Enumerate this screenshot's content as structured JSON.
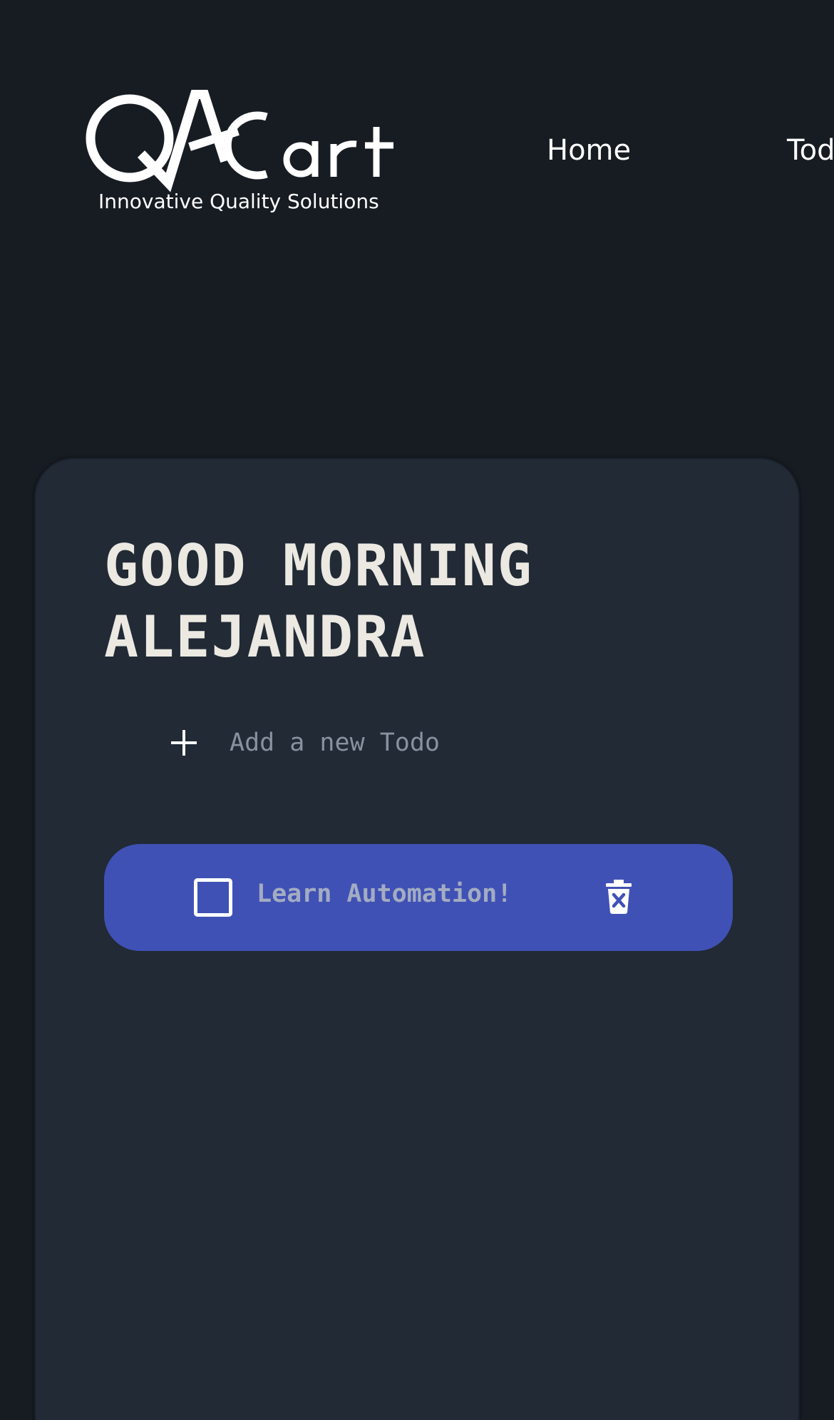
{
  "header": {
    "logo": {
      "wordmark": "QACart",
      "tagline": "Innovative Quality Solutions"
    },
    "nav": [
      {
        "label": "Home"
      },
      {
        "label": "Todo"
      }
    ]
  },
  "main": {
    "greeting": "GOOD MORNING ALEJANDRA",
    "new_todo": {
      "placeholder": "Add a new Todo",
      "value": ""
    },
    "todos": [
      {
        "text": "Learn Automation!",
        "completed": false
      }
    ]
  },
  "colors": {
    "page_background": "#171c23",
    "card_background": "#212a35",
    "todo_background": "#4051b5",
    "heading_text": "#ece9e2",
    "muted_text": "#8791a0"
  },
  "icons": {
    "add": "plus-icon",
    "checkbox": "checkbox-icon",
    "delete": "trash-icon"
  }
}
